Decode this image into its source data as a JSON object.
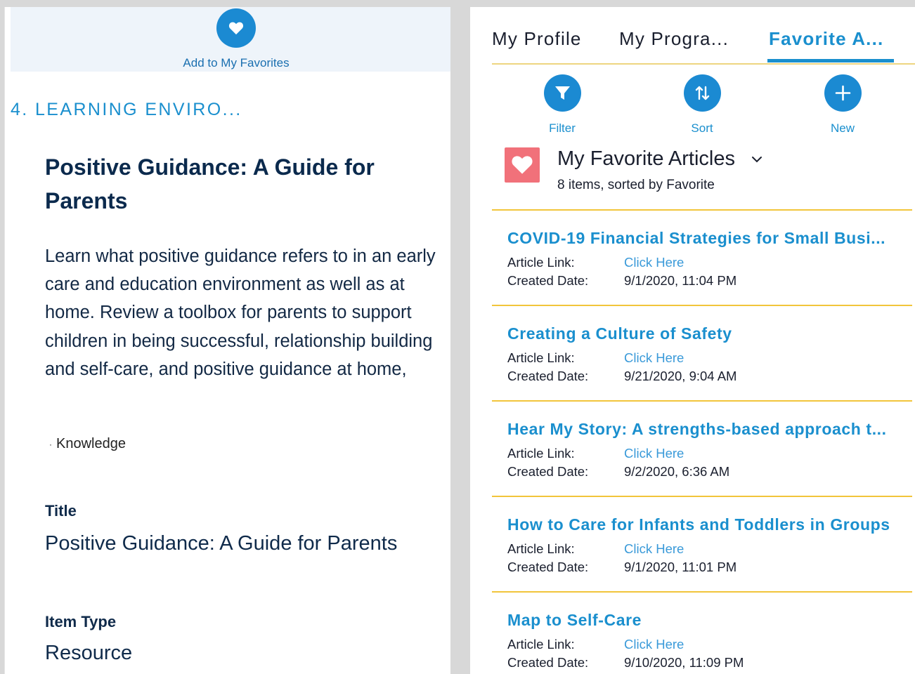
{
  "left": {
    "favorite_label": "Add to My Favorites",
    "section_heading": "4. LEARNING ENVIRO...",
    "article_title": "Positive Guidance: A Guide for Parents",
    "article_description": "Learn what positive guidance refers to in an early care and education environment as well as at home. Review a toolbox for parents to support children in being successful, relationship building and self-care, and positive guidance at home,",
    "topic_bullet": "·",
    "topic": "Knowledge",
    "fields": {
      "title_label": "Title",
      "title_value": "Positive Guidance: A Guide for Parents",
      "type_label": "Item Type",
      "type_value": "Resource"
    }
  },
  "right": {
    "tabs": [
      {
        "label": "My Profile"
      },
      {
        "label": "My Progra..."
      },
      {
        "label": "Favorite A..."
      }
    ],
    "active_tab": "Favorite A...",
    "actions": {
      "filter": "Filter",
      "sort": "Sort",
      "new": "New"
    },
    "list": {
      "title": "My Favorite Articles",
      "subtitle": "8 items, sorted by Favorite"
    },
    "field_labels": {
      "article_link": "Article Link:",
      "created_date": "Created Date:"
    },
    "items": [
      {
        "title": "COVID-19 Financial Strategies for Small Busi...",
        "link_text": "Click Here",
        "created": "9/1/2020, 11:04 PM"
      },
      {
        "title": "Creating a Culture of Safety",
        "link_text": "Click Here",
        "created": "9/21/2020, 9:04 AM"
      },
      {
        "title": "Hear My Story: A strengths-based approach t...",
        "link_text": "Click Here",
        "created": "9/2/2020, 6:36 AM"
      },
      {
        "title": "How to Care for Infants and Toddlers in Groups",
        "link_text": "Click Here",
        "created": "9/1/2020, 11:01 PM"
      },
      {
        "title": "Map to Self-Care",
        "link_text": "Click Here",
        "created": "9/10/2020, 11:09 PM"
      }
    ]
  },
  "colors": {
    "accent": "#1a8fce",
    "heading_navy": "#0b2a4d",
    "divider_yellow": "#f2c53b",
    "favorite_pink": "#f1717a"
  }
}
